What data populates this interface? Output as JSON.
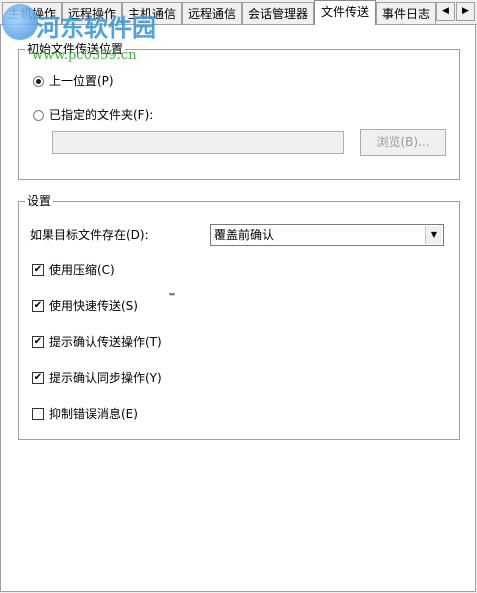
{
  "tabs": [
    {
      "label": "主机操作",
      "active": false
    },
    {
      "label": "远程操作",
      "active": false
    },
    {
      "label": "主机通信",
      "active": false
    },
    {
      "label": "远程通信",
      "active": false
    },
    {
      "label": "会话管理器",
      "active": false
    },
    {
      "label": "文件传送",
      "active": true
    },
    {
      "label": "事件日志",
      "active": false
    }
  ],
  "tab_scroll": {
    "left_icon": "arrow-left-icon",
    "right_icon": "arrow-right-icon",
    "left_glyph": "◀",
    "right_glyph": "▶"
  },
  "watermark": {
    "title": "河东软件园",
    "url": "www.pc0359.cn"
  },
  "location_group": {
    "legend": "初始文件传送位置",
    "options": [
      {
        "label": "上一位置(P)",
        "selected": true
      },
      {
        "label": "已指定的文件夹(F):",
        "selected": false
      }
    ],
    "folder_value": "",
    "browse_label": "浏览(B)..."
  },
  "settings_group": {
    "legend": "设置",
    "if_exists_label": "如果目标文件存在(D):",
    "if_exists_value": "覆盖前确认",
    "checkboxes": [
      {
        "label": "使用压缩(C)",
        "checked": true
      },
      {
        "label": "使用快速传送(S)",
        "checked": true
      },
      {
        "label": "提示确认传送操作(T)",
        "checked": true
      },
      {
        "label": "提示确认同步操作(Y)",
        "checked": true
      },
      {
        "label": "抑制错误消息(E)",
        "checked": false
      }
    ],
    "trademark": "™"
  }
}
